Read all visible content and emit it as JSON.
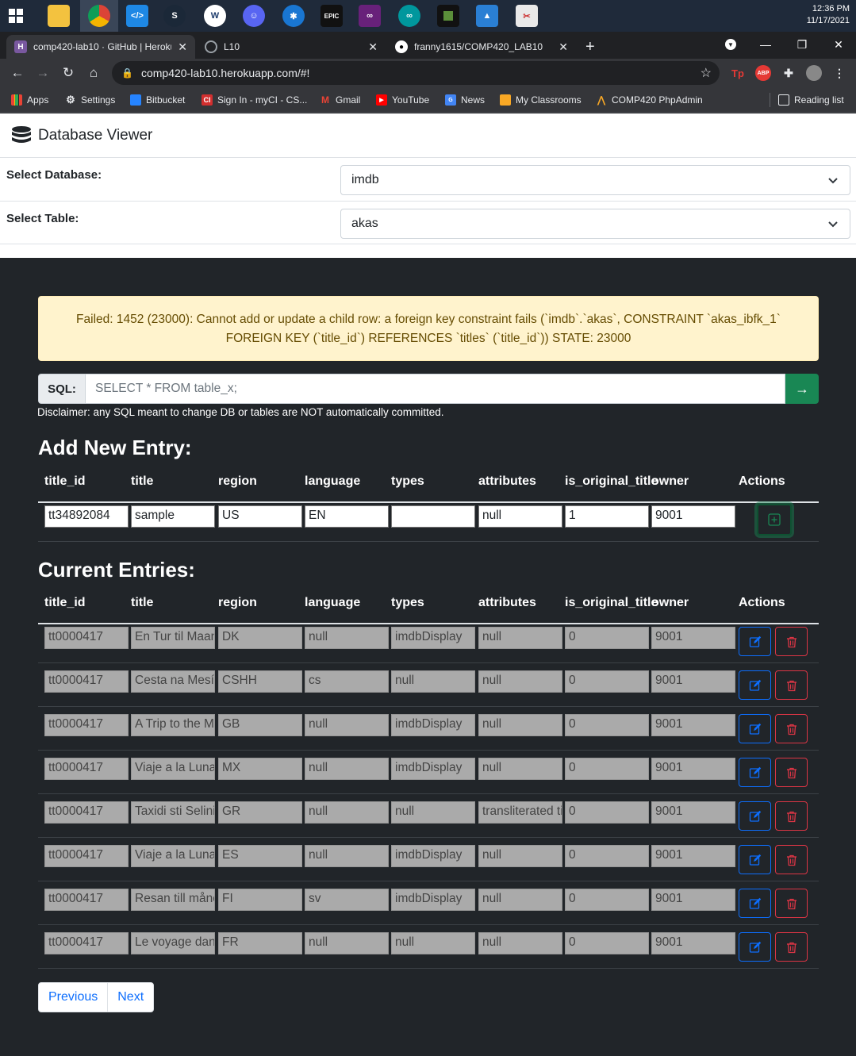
{
  "os": {
    "time": "12:36 PM",
    "date": "11/17/2021"
  },
  "browser": {
    "tabs": [
      {
        "label": "comp420-lab10 · GitHub | Heroku",
        "fav": "H"
      },
      {
        "label": "L10",
        "fav": "globe"
      },
      {
        "label": "franny1615/COMP420_LAB10",
        "fav": "github"
      }
    ],
    "new_tab": "+",
    "url": "comp420-lab10.herokuapp.com/#!",
    "bookmarks": [
      "Apps",
      "Settings",
      "Bitbucket",
      "Sign In - myCI - CS...",
      "Gmail",
      "YouTube",
      "News",
      "My Classrooms",
      "COMP420 PhpAdmin"
    ],
    "reading_list": "Reading list",
    "extensions": [
      "Tp",
      "ABP"
    ]
  },
  "app": {
    "brand": "Database Viewer",
    "select_database_label": "Select Database:",
    "select_database_value": "imdb",
    "select_table_label": "Select Table:",
    "select_table_value": "akas",
    "alert": "Failed: 1452 (23000): Cannot add or update a child row: a foreign key constraint fails (`imdb`.`akas`, CONSTRAINT `akas_ibfk_1` FOREIGN KEY (`title_id`) REFERENCES `titles` (`title_id`)) STATE: 23000",
    "sql_label": "SQL:",
    "sql_placeholder": "SELECT * FROM table_x;",
    "sql_go": "→",
    "disclaimer": "Disclaimer: any SQL meant to change DB or tables are NOT automatically committed.",
    "add_heading": "Add New Entry:",
    "current_heading": "Current Entries:",
    "columns": [
      "title_id",
      "title",
      "region",
      "language",
      "types",
      "attributes",
      "is_original_title",
      "owner",
      "Actions"
    ],
    "new_entry": [
      "tt34892084",
      "sample",
      "US",
      "EN",
      "",
      "null",
      "1",
      "9001"
    ],
    "entries": [
      [
        "tt0000417",
        "En Tur til Maanen",
        "DK",
        "null",
        "imdbDisplay",
        "null",
        "0",
        "9001"
      ],
      [
        "tt0000417",
        "Cesta na Mesíc",
        "CSHH",
        "cs",
        "null",
        "null",
        "0",
        "9001"
      ],
      [
        "tt0000417",
        "A Trip to the Moon",
        "GB",
        "null",
        "imdbDisplay",
        "null",
        "0",
        "9001"
      ],
      [
        "tt0000417",
        "Viaje a la Luna",
        "MX",
        "null",
        "imdbDisplay",
        "null",
        "0",
        "9001"
      ],
      [
        "tt0000417",
        "Taxidi sti Selini",
        "GR",
        "null",
        "null",
        "transliterated title",
        "0",
        "9001"
      ],
      [
        "tt0000417",
        "Viaje a la Luna",
        "ES",
        "null",
        "imdbDisplay",
        "null",
        "0",
        "9001"
      ],
      [
        "tt0000417",
        "Resan till månen",
        "FI",
        "sv",
        "imdbDisplay",
        "null",
        "0",
        "9001"
      ],
      [
        "tt0000417",
        "Le voyage dans la lune",
        "FR",
        "null",
        "null",
        "null",
        "0",
        "9001"
      ]
    ],
    "pager": [
      "Previous",
      "Next"
    ]
  }
}
